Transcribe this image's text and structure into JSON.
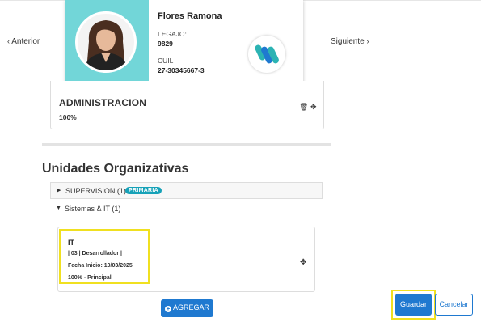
{
  "nav": {
    "prev_label": "Anterior",
    "next_label": "Siguiente"
  },
  "employee": {
    "name": "Flores Ramona",
    "legajo_label": "LEGAJO:",
    "legajo": "9829",
    "cuil_label": "CUIL",
    "cuil": "27-30345667-3"
  },
  "admin": {
    "title": "ADMINISTRACION",
    "percent": "100%"
  },
  "section": {
    "title": "Unidades Organizativas"
  },
  "groups": [
    {
      "label": "SUPERVISION (1)",
      "badge": "PRIMARIA",
      "expanded": false
    },
    {
      "label": "Sistemas & IT (1)",
      "expanded": true
    }
  ],
  "unit": {
    "title": "IT",
    "line1": "| 03 | Desarrollador |",
    "line2": "Fecha Inicio: 10/03/2025",
    "line3": "100% - Principal"
  },
  "actions": {
    "add_label": "AGREGAR",
    "save_label": "Guardar",
    "cancel_label": "Cancelar"
  },
  "colors": {
    "photo_bg": "#72d6d8",
    "primary": "#1f79d0",
    "badge": "#17a2b8",
    "highlight": "#f0e020"
  }
}
